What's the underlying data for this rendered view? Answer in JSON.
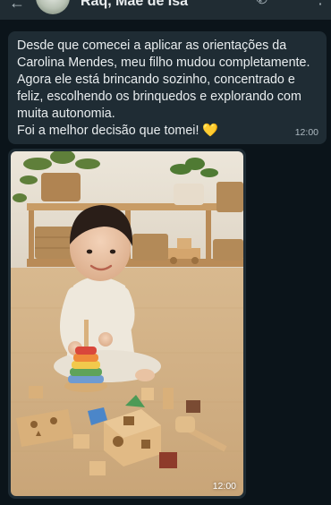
{
  "header": {
    "back_icon": "arrow-left-icon",
    "contact_name": "Raq, Mãe de Isa",
    "icons": [
      "phone-icon",
      "more-vertical-icon"
    ]
  },
  "messages": [
    {
      "type": "text",
      "lines": [
        "Desde que comecei a aplicar as orientações da",
        "Carolina Mendes, meu filho mudou completamente.",
        "Agora ele está brincando sozinho, concentrado e",
        "feliz, escolhendo os brinquedos e explorando com",
        "muita autonomia.",
        "Foi a melhor decisão que tomei!"
      ],
      "emoji": "💛",
      "time": "12:00"
    },
    {
      "type": "image",
      "image_subject": "child-playing-montessori-toys",
      "time": "12:00"
    }
  ],
  "colors": {
    "chat_background": "#0b141a",
    "bubble": "#1f2c34",
    "header": "#202c33",
    "text": "#e9edef",
    "meta": "#aebac1"
  }
}
